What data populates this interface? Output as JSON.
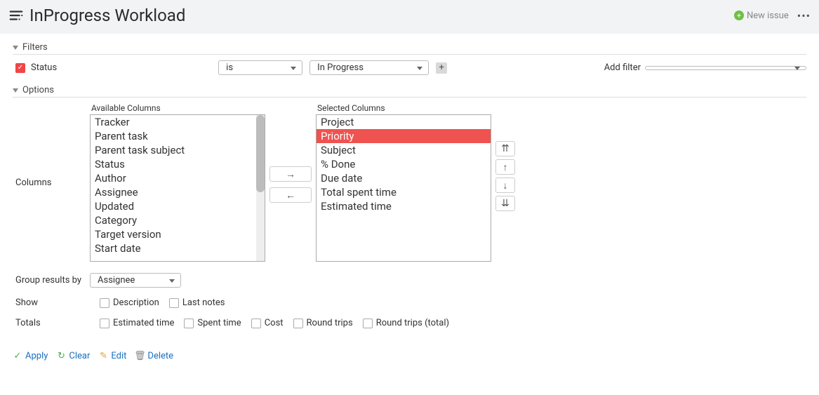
{
  "header": {
    "title": "InProgress Workload",
    "new_issue_label": "New issue"
  },
  "sections": {
    "filters_label": "Filters",
    "options_label": "Options"
  },
  "filter": {
    "field_label": "Status",
    "operator": "is",
    "value": "In Progress",
    "add_filter_label": "Add filter"
  },
  "columns": {
    "side_label": "Columns",
    "available_label": "Available Columns",
    "selected_label": "Selected Columns",
    "available": [
      "Tracker",
      "Parent task",
      "Parent task subject",
      "Status",
      "Author",
      "Assignee",
      "Updated",
      "Category",
      "Target version",
      "Start date"
    ],
    "selected": [
      "Project",
      "Priority",
      "Subject",
      "% Done",
      "Due date",
      "Total spent time",
      "Estimated time"
    ],
    "highlighted_selected_index": 1
  },
  "group": {
    "label": "Group results by",
    "value": "Assignee"
  },
  "show": {
    "label": "Show",
    "description": "Description",
    "last_notes": "Last notes"
  },
  "totals": {
    "label": "Totals",
    "items": [
      "Estimated time",
      "Spent time",
      "Cost",
      "Round trips",
      "Round trips (total)"
    ]
  },
  "actions": {
    "apply": "Apply",
    "clear": "Clear",
    "edit": "Edit",
    "delete": "Delete"
  }
}
